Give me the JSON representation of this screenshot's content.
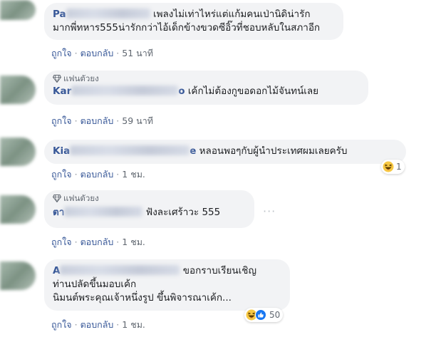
{
  "comments": [
    {
      "author_visible": "Pa",
      "text_lines": [
        "เพลงไม่เท่าไหร่แต่แก้มคนเป่านิดิน่ารัก",
        "มากพี่ทหาร555น่ารักกว่าไอ้เด็กข้างขวดซีอิ๊วที่ชอบหลับในสภาอีก"
      ],
      "like": "ถูกใจ",
      "reply": "ตอบกลับ",
      "time": "51 นาที"
    },
    {
      "fan_label": "แฟนตัวยง",
      "author_visible": "Kar",
      "author_suffix": "o",
      "text": "เค้กไม่ต้องกูขอดอกไม้จันทน์เลย",
      "like": "ถูกใจ",
      "reply": "ตอบกลับ",
      "time": "59 นาที"
    },
    {
      "author_visible": "Kia",
      "author_suffix": "e",
      "text": "หลอนพอๆกับผู้นำประเทศผมเลยครับ",
      "like": "ถูกใจ",
      "reply": "ตอบกลับ",
      "time": "1 ชม.",
      "reaction_count": "1",
      "reaction_icons": [
        "haha-emoji-icon"
      ]
    },
    {
      "fan_label": "แฟนตัวยง",
      "author_visible": "ตา",
      "text": "ฟังละเศร้าวะ 555",
      "like": "ถูกใจ",
      "reply": "ตอบกลับ",
      "time": "1 ชม.",
      "more_icon": "more-options-icon"
    },
    {
      "author_visible": "A",
      "text_lines": [
        "ขอกราบเรียนเชิญ",
        "ท่านปลัดขึ้นมอบเค้ก",
        "นิมนต์พระคุณเจ้าหนึ่งรูป ขึ้นพิจารณาเค้ก..."
      ],
      "like": "ถูกใจ",
      "reply": "ตอบกลับ",
      "time": "1 ชม.",
      "reaction_count": "50",
      "reaction_icons": [
        "haha-emoji-icon",
        "like-thumb-icon"
      ]
    }
  ],
  "colors": {
    "bubble": "#f2f3f5",
    "name": "#385898",
    "meta": "#606770",
    "text": "#1c1e21"
  },
  "separator": "·"
}
